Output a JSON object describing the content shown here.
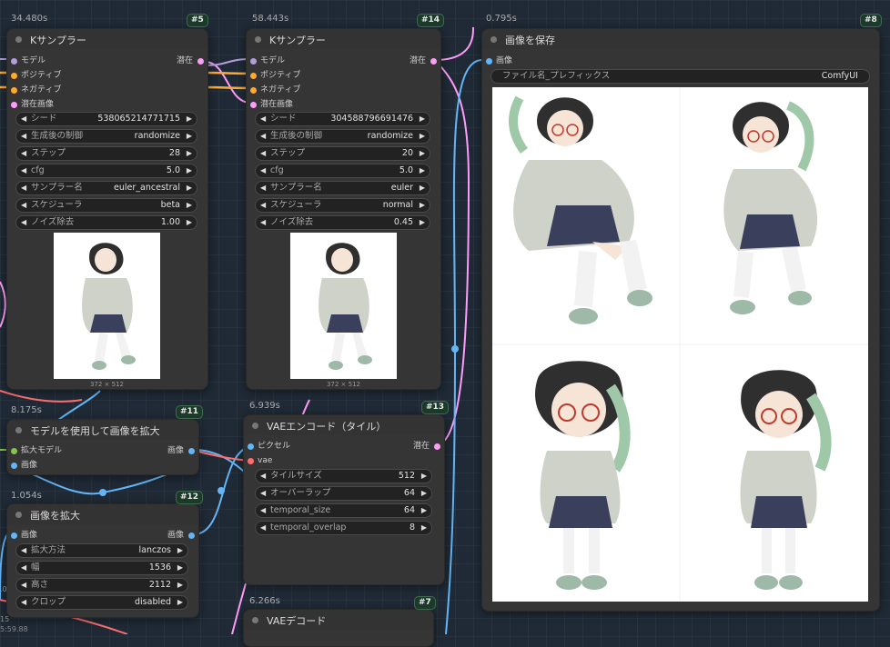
{
  "nodes": {
    "ks5": {
      "time": "34.480s",
      "id": "#5",
      "title": "Kサンプラー",
      "inputs": [
        "モデル",
        "ポジティブ",
        "ネガティブ",
        "潜在画像"
      ],
      "output": "潜在",
      "widgets": [
        {
          "label": "シード",
          "value": "538065214771715"
        },
        {
          "label": "生成後の制御",
          "value": "randomize"
        },
        {
          "label": "ステップ",
          "value": "28"
        },
        {
          "label": "cfg",
          "value": "5.0"
        },
        {
          "label": "サンプラー名",
          "value": "euler_ancestral"
        },
        {
          "label": "スケジューラ",
          "value": "beta"
        },
        {
          "label": "ノイズ除去",
          "value": "1.00"
        }
      ],
      "preview_caption": "372 × 512"
    },
    "ks14": {
      "time": "58.443s",
      "id": "#14",
      "title": "Kサンプラー",
      "inputs": [
        "モデル",
        "ポジティブ",
        "ネガティブ",
        "潜在画像"
      ],
      "output": "潜在",
      "widgets": [
        {
          "label": "シード",
          "value": "304588796691476"
        },
        {
          "label": "生成後の制御",
          "value": "randomize"
        },
        {
          "label": "ステップ",
          "value": "20"
        },
        {
          "label": "cfg",
          "value": "5.0"
        },
        {
          "label": "サンプラー名",
          "value": "euler"
        },
        {
          "label": "スケジューラ",
          "value": "normal"
        },
        {
          "label": "ノイズ除去",
          "value": "0.45"
        }
      ],
      "preview_caption": "372 × 512"
    },
    "save8": {
      "time": "0.795s",
      "id": "#8",
      "title": "画像を保存",
      "input": "画像",
      "prefix_label": "ファイル名_プレフィックス",
      "prefix_value": "ComfyUI"
    },
    "upscale11": {
      "time": "8.175s",
      "id": "#11",
      "title": "モデルを使用して画像を拡大",
      "inputs": [
        "拡大モデル",
        "画像"
      ],
      "output": "画像"
    },
    "scale12": {
      "time": "1.054s",
      "id": "#12",
      "title": "画像を拡大",
      "input": "画像",
      "output": "画像",
      "widgets": [
        {
          "label": "拡大方法",
          "value": "lanczos"
        },
        {
          "label": "幅",
          "value": "1536"
        },
        {
          "label": "高さ",
          "value": "2112"
        },
        {
          "label": "クロップ",
          "value": "disabled"
        }
      ]
    },
    "vae13": {
      "time": "6.939s",
      "id": "#13",
      "title": "VAEエンコード（タイル）",
      "inputs": [
        "ピクセル",
        "vae"
      ],
      "output": "潜在",
      "widgets": [
        {
          "label": "タイルサイズ",
          "value": "512"
        },
        {
          "label": "オーバーラップ",
          "value": "64"
        },
        {
          "label": "temporal_size",
          "value": "64"
        },
        {
          "label": "temporal_overlap",
          "value": "8"
        }
      ]
    },
    "vae7": {
      "time": "6.266s",
      "id": "#7",
      "title": "VAEデコード"
    }
  },
  "edge_text": {
    "left1": ".0",
    "left2": "15",
    "left3": "5:59.88"
  },
  "colors": {
    "model": "#b39ddb",
    "conditioning": "#ffa931",
    "latent": "#ff9cf9",
    "image": "#64b5f6",
    "vae": "#ff6e6e",
    "upscale_model": "#8bc34a"
  }
}
